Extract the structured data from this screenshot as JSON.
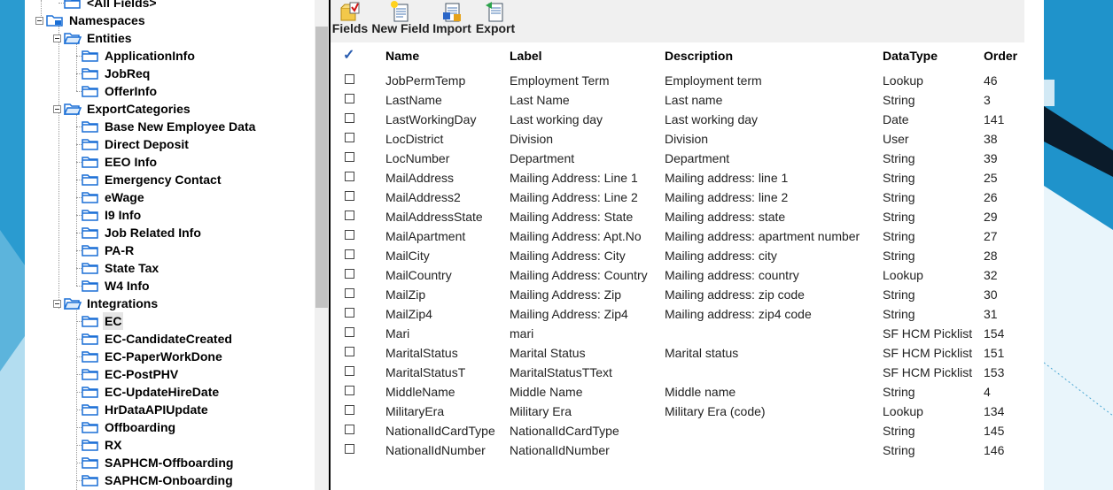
{
  "tree": {
    "items": [
      {
        "label": "<All Fields>",
        "level": 1,
        "icon": "folder-icon"
      },
      {
        "label": "Namespaces",
        "level": 0,
        "icon": "namespace-folder-icon",
        "expander": true
      },
      {
        "label": "Entities",
        "level": 1,
        "icon": "folder-open-icon",
        "expander": true
      },
      {
        "label": "ApplicationInfo",
        "level": 2,
        "icon": "folder-icon"
      },
      {
        "label": "JobReq",
        "level": 2,
        "icon": "folder-icon"
      },
      {
        "label": "OfferInfo",
        "level": 2,
        "icon": "folder-icon"
      },
      {
        "label": "ExportCategories",
        "level": 1,
        "icon": "folder-open-icon",
        "expander": true
      },
      {
        "label": "Base New Employee Data",
        "level": 2,
        "icon": "folder-icon"
      },
      {
        "label": "Direct Deposit",
        "level": 2,
        "icon": "folder-icon"
      },
      {
        "label": "EEO Info",
        "level": 2,
        "icon": "folder-icon"
      },
      {
        "label": "Emergency Contact",
        "level": 2,
        "icon": "folder-icon"
      },
      {
        "label": "eWage",
        "level": 2,
        "icon": "folder-icon"
      },
      {
        "label": "I9 Info",
        "level": 2,
        "icon": "folder-icon"
      },
      {
        "label": "Job Related Info",
        "level": 2,
        "icon": "folder-icon"
      },
      {
        "label": "PA-R",
        "level": 2,
        "icon": "folder-icon"
      },
      {
        "label": "State Tax",
        "level": 2,
        "icon": "folder-icon"
      },
      {
        "label": "W4 Info",
        "level": 2,
        "icon": "folder-icon"
      },
      {
        "label": "Integrations",
        "level": 1,
        "icon": "folder-open-icon",
        "expander": true
      },
      {
        "label": "EC",
        "level": 2,
        "icon": "folder-icon",
        "selected": true
      },
      {
        "label": "EC-CandidateCreated",
        "level": 2,
        "icon": "folder-icon"
      },
      {
        "label": "EC-PaperWorkDone",
        "level": 2,
        "icon": "folder-icon"
      },
      {
        "label": "EC-PostPHV",
        "level": 2,
        "icon": "folder-icon"
      },
      {
        "label": "EC-UpdateHireDate",
        "level": 2,
        "icon": "folder-icon"
      },
      {
        "label": "HrDataAPIUpdate",
        "level": 2,
        "icon": "folder-icon"
      },
      {
        "label": "Offboarding",
        "level": 2,
        "icon": "folder-icon"
      },
      {
        "label": "RX",
        "level": 2,
        "icon": "folder-icon"
      },
      {
        "label": "SAPHCM-Offboarding",
        "level": 2,
        "icon": "folder-icon"
      },
      {
        "label": "SAPHCM-Onboarding",
        "level": 2,
        "icon": "folder-icon"
      }
    ]
  },
  "toolbar": {
    "buttons": [
      {
        "label": "Fields",
        "icon": "fields-icon"
      },
      {
        "label": "New Field",
        "icon": "new-field-icon"
      },
      {
        "label": "Import",
        "icon": "import-icon"
      },
      {
        "label": "Export",
        "icon": "export-icon"
      }
    ]
  },
  "grid": {
    "header_check": "✓",
    "columns": [
      "Name",
      "Label",
      "Description",
      "DataType",
      "Order"
    ],
    "rows": [
      [
        "JobPermTemp",
        "Employment Term",
        "Employment term",
        "Lookup",
        "46"
      ],
      [
        "LastName",
        "Last Name",
        "Last name",
        "String",
        "3"
      ],
      [
        "LastWorkingDay",
        "Last working day",
        "Last working day",
        "Date",
        "141"
      ],
      [
        "LocDistrict",
        "Division",
        "Division",
        "User",
        "38"
      ],
      [
        "LocNumber",
        "Department",
        "Department",
        "String",
        "39"
      ],
      [
        "MailAddress",
        "Mailing Address: Line 1",
        "Mailing address: line 1",
        "String",
        "25"
      ],
      [
        "MailAddress2",
        "Mailing Address: Line 2",
        "Mailing address: line 2",
        "String",
        "26"
      ],
      [
        "MailAddressState",
        "Mailing Address: State",
        "Mailing address: state",
        "String",
        "29"
      ],
      [
        "MailApartment",
        "Mailing Address: Apt.No",
        "Mailing address: apartment number",
        "String",
        "27"
      ],
      [
        "MailCity",
        "Mailing Address: City",
        "Mailing address: city",
        "String",
        "28"
      ],
      [
        "MailCountry",
        "Mailing Address: Country",
        "Mailing address: country",
        "Lookup",
        "32"
      ],
      [
        "MailZip",
        "Mailing Address: Zip",
        "Mailing address: zip code",
        "String",
        "30"
      ],
      [
        "MailZip4",
        "Mailing Address: Zip4",
        "Mailing address: zip4 code",
        "String",
        "31"
      ],
      [
        "Mari",
        "mari",
        "",
        "SF HCM Picklist",
        "154"
      ],
      [
        "MaritalStatus",
        "Marital Status",
        "Marital status",
        "SF HCM Picklist",
        "151"
      ],
      [
        "MaritalStatusT",
        "MaritalStatusTText",
        "",
        "SF HCM Picklist",
        "153"
      ],
      [
        "MiddleName",
        "Middle Name",
        "Middle name",
        "String",
        "4"
      ],
      [
        "MilitaryEra",
        "Military Era",
        "Military Era (code)",
        "Lookup",
        "134"
      ],
      [
        "NationalIdCardType",
        "NationalIdCardType",
        "",
        "String",
        "145"
      ],
      [
        "NationalIdNumber",
        "NationalIdNumber",
        "",
        "String",
        "146"
      ]
    ]
  },
  "colors": {
    "desktop_bg": "#1e8fc4",
    "panel_bg": "#ffffff",
    "toolbar_bg": "#f0f0f0",
    "folder": "#1a6fd6"
  }
}
